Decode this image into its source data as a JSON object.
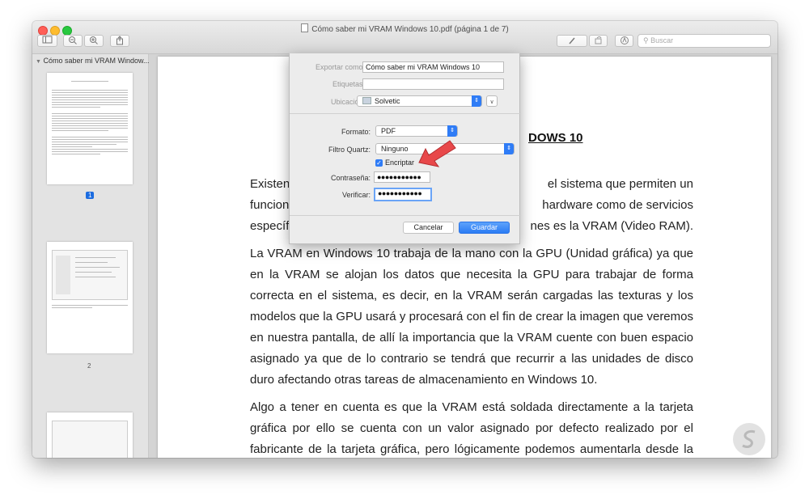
{
  "window": {
    "title": "Cómo saber mi VRAM Windows 10.pdf (página 1 de 7)"
  },
  "toolbar": {
    "search_placeholder": "Buscar",
    "sidebar_icon": "sidebar-toggle-icon",
    "zoom_out_icon": "zoom-out-icon",
    "zoom_in_icon": "zoom-in-icon",
    "share_icon": "share-icon",
    "markup_icon": "pen-icon",
    "rotate_icon": "rotate-icon",
    "annotate_icon": "markup-circle-icon",
    "search_icon": "search-icon"
  },
  "sidebar": {
    "header": "Cómo saber mi VRAM Window...",
    "pages": [
      "1",
      "2"
    ]
  },
  "document": {
    "heading": "DOWS 10",
    "para1_lines": [
      "Existen",
      "el sistema que permiten un",
      "funcionar",
      "hardware como de servicios",
      "específic",
      "nes es la VRAM (Video RAM)."
    ],
    "para2": "La VRAM en Windows 10 trabaja de la mano con la GPU (Unidad gráfica) ya que en la VRAM se alojan los  datos que necesita la GPU para trabajar de forma correcta en el sistema, es decir, en la VRAM serán cargadas las texturas y los modelos que la GPU usará y procesará con el fin de crear la imagen que veremos en nuestra pantalla, de allí la importancia que la VRAM cuente con buen espacio asignado ya que de lo contrario se tendrá que recurrir a las unidades de disco duro afectando otras tareas de almacenamiento en Windows 10.",
    "para3": "Algo a tener en cuenta es que la VRAM está soldada directamente a la tarjeta gráfica por ello se cuenta con un valor asignado por defecto realizado por el fabricante de la tarjeta gráfica, pero lógicamente  podemos aumentarla desde la configuración del"
  },
  "dialog": {
    "export_label": "Exportar como:",
    "export_value": "Cómo saber mi VRAM Windows 10",
    "tags_label": "Etiquetas:",
    "tags_value": "",
    "location_label": "Ubicación:",
    "location_value": "Solvetic",
    "format_label": "Formato:",
    "format_value": "PDF",
    "quartz_label": "Filtro Quartz:",
    "quartz_value": "Ninguno",
    "encrypt_label": "Encriptar",
    "encrypt_checked": true,
    "password_label": "Contraseña:",
    "password_value": "●●●●●●●●●●●",
    "verify_label": "Verificar:",
    "verify_value": "●●●●●●●●●●●",
    "cancel_label": "Cancelar",
    "save_label": "Guardar"
  },
  "colors": {
    "accent": "#2f7cf6",
    "arrow": "#e8484a"
  }
}
